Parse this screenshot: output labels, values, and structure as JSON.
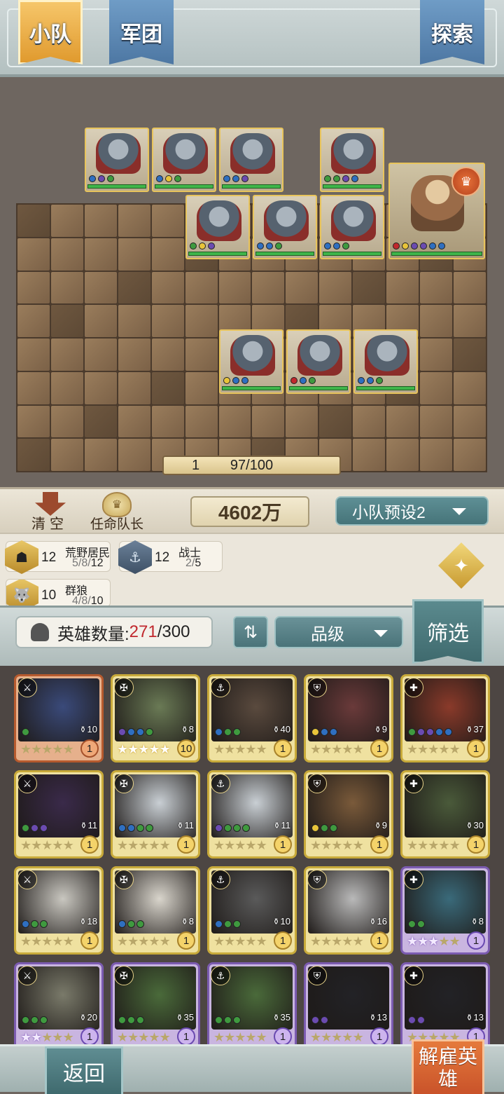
{
  "tabs": {
    "squad": "小队",
    "legion": "军团",
    "explore": "探索"
  },
  "board": {
    "level": "1",
    "capacity": "97/100"
  },
  "controls": {
    "clear": "清空",
    "appoint_captain": "任命队长",
    "power": "4602万",
    "preset": "小队预设2"
  },
  "synergies": [
    {
      "icon": "wildling-icon",
      "count": "12",
      "name": "荒野居民",
      "progress_prefix": "5/8/",
      "progress_current": "12"
    },
    {
      "icon": "warrior-icon",
      "count": "12",
      "name": "战士",
      "progress_prefix": "2/",
      "progress_current": "5"
    },
    {
      "icon": "wolfpack-icon",
      "count": "10",
      "name": "群狼",
      "progress_prefix": "4/8/",
      "progress_current": "10"
    }
  ],
  "roster": {
    "label": "英雄数量:",
    "current": "271",
    "max": "/300",
    "grade": "品级",
    "filter": "筛选"
  },
  "heroes": [
    {
      "rarity": "red",
      "cost": "10",
      "level": "1",
      "stars_on": 0,
      "dots": [
        "#3f9a3f"
      ],
      "art": "#3a4a7a"
    },
    {
      "rarity": "gold",
      "cost": "8",
      "level": "10",
      "stars_on": 5,
      "dots": [
        "#6b4bb0",
        "#2f6fc0",
        "#2f6fc0",
        "#3f9a3f"
      ],
      "art": "#6a7a55"
    },
    {
      "rarity": "gold",
      "cost": "40",
      "level": "1",
      "stars_on": 0,
      "dots": [
        "#2f6fc0",
        "#3f9a3f",
        "#3f9a3f"
      ],
      "art": "#5a4a3e"
    },
    {
      "rarity": "gold",
      "cost": "9",
      "level": "1",
      "stars_on": 0,
      "dots": [
        "#e8c43a",
        "#2f6fc0",
        "#2f6fc0"
      ],
      "art": "#6a3a3a"
    },
    {
      "rarity": "gold",
      "cost": "37",
      "level": "1",
      "stars_on": 0,
      "dots": [
        "#3f9a3f",
        "#6b4bb0",
        "#6b4bb0",
        "#2f6fc0",
        "#2f6fc0"
      ],
      "art": "#8a3a2a"
    },
    {
      "rarity": "gold",
      "cost": "11",
      "level": "1",
      "stars_on": 0,
      "dots": [
        "#3f9a3f",
        "#6b4bb0",
        "#6b4bb0"
      ],
      "art": "#3a2a4a"
    },
    {
      "rarity": "gold",
      "cost": "11",
      "level": "1",
      "stars_on": 0,
      "dots": [
        "#2f6fc0",
        "#2f6fc0",
        "#3f9a3f",
        "#3f9a3f"
      ],
      "art": "#c9cfd4"
    },
    {
      "rarity": "gold",
      "cost": "11",
      "level": "1",
      "stars_on": 0,
      "dots": [
        "#6b4bb0",
        "#3f9a3f",
        "#3f9a3f",
        "#3f9a3f"
      ],
      "art": "#c9cfd4"
    },
    {
      "rarity": "gold",
      "cost": "9",
      "level": "1",
      "stars_on": 0,
      "dots": [
        "#e8c43a",
        "#3f9a3f",
        "#3f9a3f"
      ],
      "art": "#7a5a3a"
    },
    {
      "rarity": "gold",
      "cost": "30",
      "level": "1",
      "stars_on": 0,
      "dots": [],
      "art": "#4a5a3a"
    },
    {
      "rarity": "gold",
      "cost": "18",
      "level": "1",
      "stars_on": 0,
      "dots": [
        "#2f6fc0",
        "#3f9a3f",
        "#3f9a3f"
      ],
      "art": "#c9c7c0"
    },
    {
      "rarity": "gold",
      "cost": "8",
      "level": "1",
      "stars_on": 0,
      "dots": [
        "#2f6fc0",
        "#3f9a3f",
        "#3f9a3f"
      ],
      "art": "#d9d5cc"
    },
    {
      "rarity": "gold",
      "cost": "10",
      "level": "1",
      "stars_on": 0,
      "dots": [
        "#2f6fc0",
        "#3f9a3f",
        "#3f9a3f"
      ],
      "art": "#5a5a5a"
    },
    {
      "rarity": "gold",
      "cost": "16",
      "level": "1",
      "stars_on": 0,
      "dots": [],
      "art": "#b9b9b9"
    },
    {
      "rarity": "purple",
      "cost": "8",
      "level": "1",
      "stars_on": 3,
      "dots": [
        "#3f9a3f",
        "#3f9a3f"
      ],
      "art": "#3a6a7a"
    },
    {
      "rarity": "purple",
      "cost": "20",
      "level": "1",
      "stars_on": 2,
      "dots": [
        "#3f9a3f",
        "#3f9a3f",
        "#3f9a3f"
      ],
      "art": "#7a7a6a"
    },
    {
      "rarity": "purple",
      "cost": "35",
      "level": "1",
      "stars_on": 0,
      "dots": [
        "#3f9a3f",
        "#3f9a3f",
        "#3f9a3f"
      ],
      "art": "#4a6a3a"
    },
    {
      "rarity": "purple",
      "cost": "35",
      "level": "1",
      "stars_on": 0,
      "dots": [
        "#3f9a3f",
        "#3f9a3f",
        "#3f9a3f"
      ],
      "art": "#4a6a3a"
    },
    {
      "rarity": "purple",
      "cost": "13",
      "level": "1",
      "stars_on": 0,
      "dots": [
        "#6b4bb0",
        "#6b4bb0"
      ],
      "art": "#222226"
    },
    {
      "rarity": "purple",
      "cost": "13",
      "level": "1",
      "stars_on": 0,
      "dots": [
        "#6b4bb0",
        "#6b4bb0"
      ],
      "art": "#222226"
    }
  ],
  "bottom": {
    "back": "返回",
    "dismiss": "解雇英雄"
  },
  "colors": {
    "count_highlight": "#c0282d",
    "accent_teal": "#4a7379",
    "accent_gold": "#e09a2e"
  }
}
